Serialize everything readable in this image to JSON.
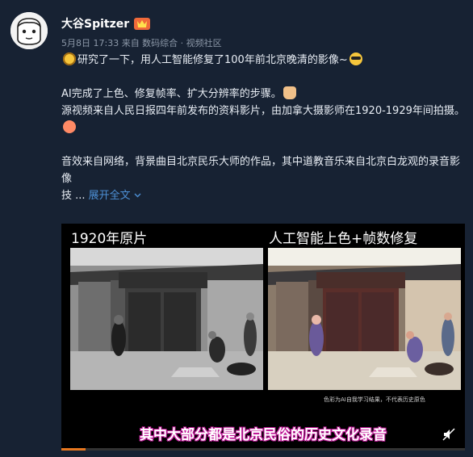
{
  "user": {
    "name": "大谷Spitzer",
    "badge_icon": "vip-badge-icon",
    "meta": "5月8日 17:33 来自 数码综合 · 视频社区"
  },
  "post": {
    "line1_text": "研究了一下，用人工智能修复了100年前北京晚清的影像~",
    "line2_text": "AI完成了上色、修复帧率、扩大分辨率的步骤。",
    "line3_text": "源视频来自人民日报四年前发布的资料影片，由加拿大摄影师在1920-1929年间拍摄。",
    "line4_text": "音效来自网络，背景曲目北京民乐大师的作品，其中道教音乐来自北京白龙观的录音影像",
    "truncated_prefix": "技 ...",
    "expand_label": "展开全文",
    "expand_icon": "chevron-down-icon"
  },
  "video": {
    "left_caption": "1920年原片",
    "right_caption": "人工智能上色+帧数修复",
    "disclaimer": "色彩为AI自我学习结果，不代表历史原色",
    "subtitle": "其中大部分都是北京民俗的历史文化录音",
    "progress": 0.06,
    "colors": {
      "accent": "#e6771f",
      "subtitle_outline": "#c21a9a",
      "link": "#4d90d6"
    }
  }
}
